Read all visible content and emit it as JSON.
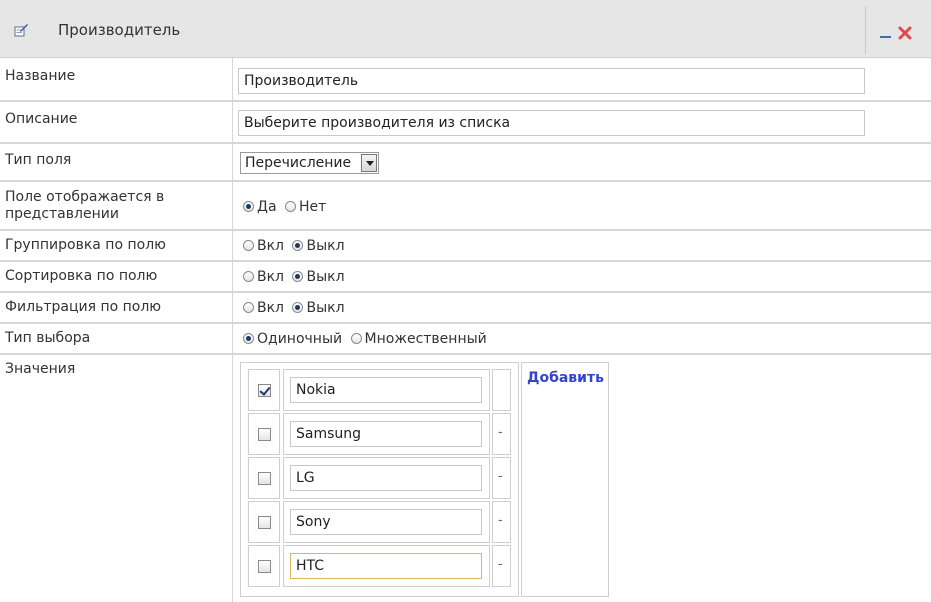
{
  "header": {
    "title": "Производитель",
    "edit_icon": "edit-icon",
    "minimize_icon": "minimize-icon",
    "close_icon": "close-icon",
    "accent": "#3b6fb0",
    "close_color": "#e04a4a"
  },
  "fields": {
    "name": {
      "label": "Название",
      "value": "Производитель"
    },
    "description": {
      "label": "Описание",
      "value": "Выберите производителя из списка"
    },
    "field_type": {
      "label": "Тип поля",
      "selected": "Перечисление"
    },
    "shown": {
      "label": "Поле отображается в представлении",
      "options": [
        "Да",
        "Нет"
      ],
      "selected": "Да"
    },
    "grouping": {
      "label": "Группировка по полю",
      "options": [
        "Вкл",
        "Выкл"
      ],
      "selected": "Выкл"
    },
    "sorting": {
      "label": "Сортировка по полю",
      "options": [
        "Вкл",
        "Выкл"
      ],
      "selected": "Выкл"
    },
    "filtering": {
      "label": "Фильтрация по полю",
      "options": [
        "Вкл",
        "Выкл"
      ],
      "selected": "Выкл"
    },
    "selection_type": {
      "label": "Тип выбора",
      "options": [
        "Одиночный",
        "Множественный"
      ],
      "selected": "Одиночный"
    }
  },
  "values": {
    "label": "Значения",
    "add_label": "Добавить",
    "remove_label": "-",
    "items": [
      {
        "text": "Nokia",
        "checked": true
      },
      {
        "text": "Samsung",
        "checked": false
      },
      {
        "text": "LG",
        "checked": false
      },
      {
        "text": "Sony",
        "checked": false
      },
      {
        "text": "HTC",
        "checked": false
      }
    ]
  }
}
